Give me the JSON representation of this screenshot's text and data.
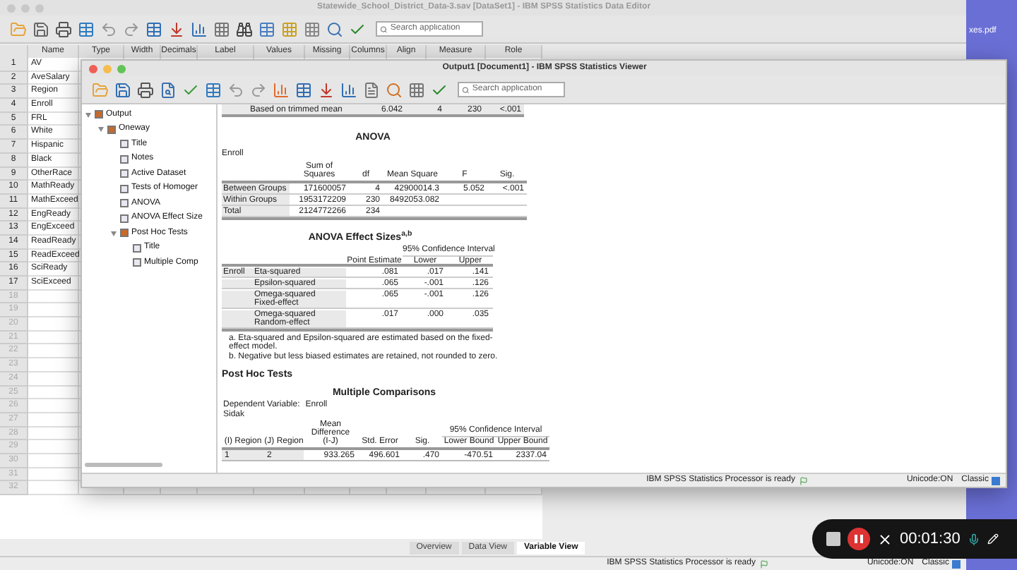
{
  "desktop": {
    "file_label": "xes.pdf"
  },
  "data_editor": {
    "title": "Statewide_School_District_Data-3.sav [DataSet1] - IBM SPSS Statistics Data Editor",
    "search": {
      "placeholder": "Search application"
    },
    "columns": [
      "Name",
      "Type",
      "Width",
      "Decimals",
      "Label",
      "Values",
      "Missing",
      "Columns",
      "Align",
      "Measure",
      "Role"
    ],
    "rows": [
      {
        "number": "1",
        "name": "AV"
      },
      {
        "number": "2",
        "name": "AveSalary"
      },
      {
        "number": "3",
        "name": "Region"
      },
      {
        "number": "4",
        "name": "Enroll"
      },
      {
        "number": "5",
        "name": "FRL"
      },
      {
        "number": "6",
        "name": "White"
      },
      {
        "number": "7",
        "name": "Hispanic"
      },
      {
        "number": "8",
        "name": "Black"
      },
      {
        "number": "9",
        "name": "OtherRace"
      },
      {
        "number": "10",
        "name": "MathReady"
      },
      {
        "number": "11",
        "name": "MathExceed"
      },
      {
        "number": "12",
        "name": "EngReady"
      },
      {
        "number": "13",
        "name": "EngExceed"
      },
      {
        "number": "14",
        "name": "ReadReady"
      },
      {
        "number": "15",
        "name": "ReadExceed"
      },
      {
        "number": "16",
        "name": "SciReady"
      },
      {
        "number": "17",
        "name": "SciExceed"
      },
      {
        "number": "18"
      },
      {
        "number": "19"
      },
      {
        "number": "20"
      },
      {
        "number": "21"
      },
      {
        "number": "22"
      },
      {
        "number": "23"
      },
      {
        "number": "24"
      },
      {
        "number": "25"
      },
      {
        "number": "26"
      },
      {
        "number": "27"
      },
      {
        "number": "28"
      },
      {
        "number": "29"
      },
      {
        "number": "30"
      },
      {
        "number": "31"
      },
      {
        "number": "32"
      }
    ],
    "view_tabs": [
      {
        "label": "Overview",
        "selected": false
      },
      {
        "label": "Data View",
        "selected": false
      },
      {
        "label": "Variable View",
        "selected": true
      }
    ],
    "status_bar": {
      "message": "IBM SPSS Statistics Processor is ready",
      "unicode": "Unicode:ON",
      "mode": "Classic"
    }
  },
  "viewer": {
    "title": "Output1 [Document1] - IBM SPSS Statistics Viewer",
    "search": {
      "placeholder": "Search application"
    },
    "navigator": [
      {
        "label": "Output",
        "expanded": true,
        "children": [
          {
            "label": "Oneway",
            "expanded": true,
            "children": [
              {
                "label": "Title"
              },
              {
                "label": "Notes"
              },
              {
                "label": "Active Dataset"
              },
              {
                "label": "Tests of Homoger"
              },
              {
                "label": "ANOVA"
              },
              {
                "label": "ANOVA Effect Size"
              },
              {
                "label": "Post Hoc Tests",
                "expanded": true,
                "children": [
                  {
                    "label": "Title"
                  },
                  {
                    "label": "Multiple Comp"
                  }
                ]
              }
            ]
          }
        ]
      }
    ],
    "trimmed_row": [
      "Based on trimmed mean",
      "6.042",
      "4",
      "230",
      "<.001"
    ],
    "anova": {
      "title": "ANOVA",
      "dependent": "Enroll",
      "columns": [
        "",
        "Sum of Squares",
        "df",
        "Mean Square",
        "F",
        "Sig."
      ],
      "rows": [
        [
          "Between Groups",
          "171600057",
          "4",
          "42900014.3",
          "5.052",
          "<.001"
        ],
        [
          "Within Groups",
          "1953172209",
          "230",
          "8492053.082",
          "",
          ""
        ],
        [
          "Total",
          "2124772266",
          "234",
          "",
          "",
          ""
        ]
      ]
    },
    "effect_sizes": {
      "title": "ANOVA Effect Sizes$^{a,b}$",
      "group_header": "95% Confidence Interval",
      "columns": [
        "",
        "Point Estimate",
        "Lower",
        "Upper"
      ],
      "group": "Enroll",
      "rows": [
        [
          "Eta-squared",
          ".081",
          ".017",
          ".141"
        ],
        [
          "Epsilon-squared",
          ".065",
          "-.001",
          ".126"
        ],
        [
          "Omega-squared Fixed-effect",
          ".065",
          "-.001",
          ".126"
        ],
        [
          "Omega-squared Random-effect",
          ".017",
          ".000",
          ".035"
        ]
      ],
      "footnotes": [
        "a. Eta-squared and Epsilon-squared are estimated based on the fixed-effect model.",
        "b. Negative but less biased estimates are retained, not rounded to zero."
      ]
    },
    "post_hoc_heading": "Post Hoc Tests",
    "multiple_comparisons": {
      "title": "Multiple Comparisons",
      "dependent_label": "Dependent Variable:",
      "dependent": "Enroll",
      "method": "Sidak",
      "group_header": "95% Confidence Interval",
      "columns": [
        "(I) Region",
        "(J) Region",
        "Mean Difference (I-J)",
        "Std. Error",
        "Sig.",
        "Lower Bound",
        "Upper Bound"
      ],
      "rows": [
        [
          "1",
          "2",
          "933.265",
          "496.601",
          ".470",
          "-470.51",
          "2337.04"
        ]
      ]
    },
    "status_bar": {
      "message": "IBM SPSS Statistics Processor is ready",
      "unicode": "Unicode:ON",
      "mode": "Classic"
    }
  },
  "recorder": {
    "time": "00:01:30"
  }
}
